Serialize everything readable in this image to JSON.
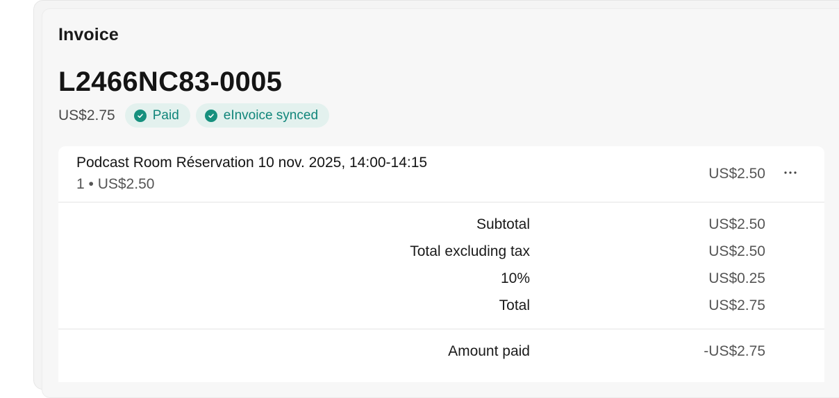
{
  "section_title": "Invoice",
  "invoice": {
    "number": "L2466NC83-0005",
    "amount": "US$2.75",
    "badges": [
      {
        "label": "Paid",
        "icon": "check-circle-icon",
        "color": "#10857a"
      },
      {
        "label": "eInvoice synced",
        "icon": "check-circle-icon",
        "color": "#10857a"
      }
    ]
  },
  "line_item": {
    "description": "Podcast Room Réservation 10 nov. 2025, 14:00-14:15",
    "quantity_price": "1 • US$2.50",
    "amount": "US$2.50",
    "more_icon": "more-horizontal-icon"
  },
  "summary": [
    {
      "label": "Subtotal",
      "value": "US$2.50"
    },
    {
      "label": "Total excluding tax",
      "value": "US$2.50"
    },
    {
      "label": "10%",
      "value": "US$0.25"
    },
    {
      "label": "Total",
      "value": "US$2.75"
    }
  ],
  "payment": {
    "label": "Amount paid",
    "value": "-US$2.75"
  },
  "colors": {
    "badge_bg": "#e3f1ee",
    "badge_text": "#10857a",
    "panel_bg": "#ffffff",
    "page_bg": "#f7f7f7"
  }
}
